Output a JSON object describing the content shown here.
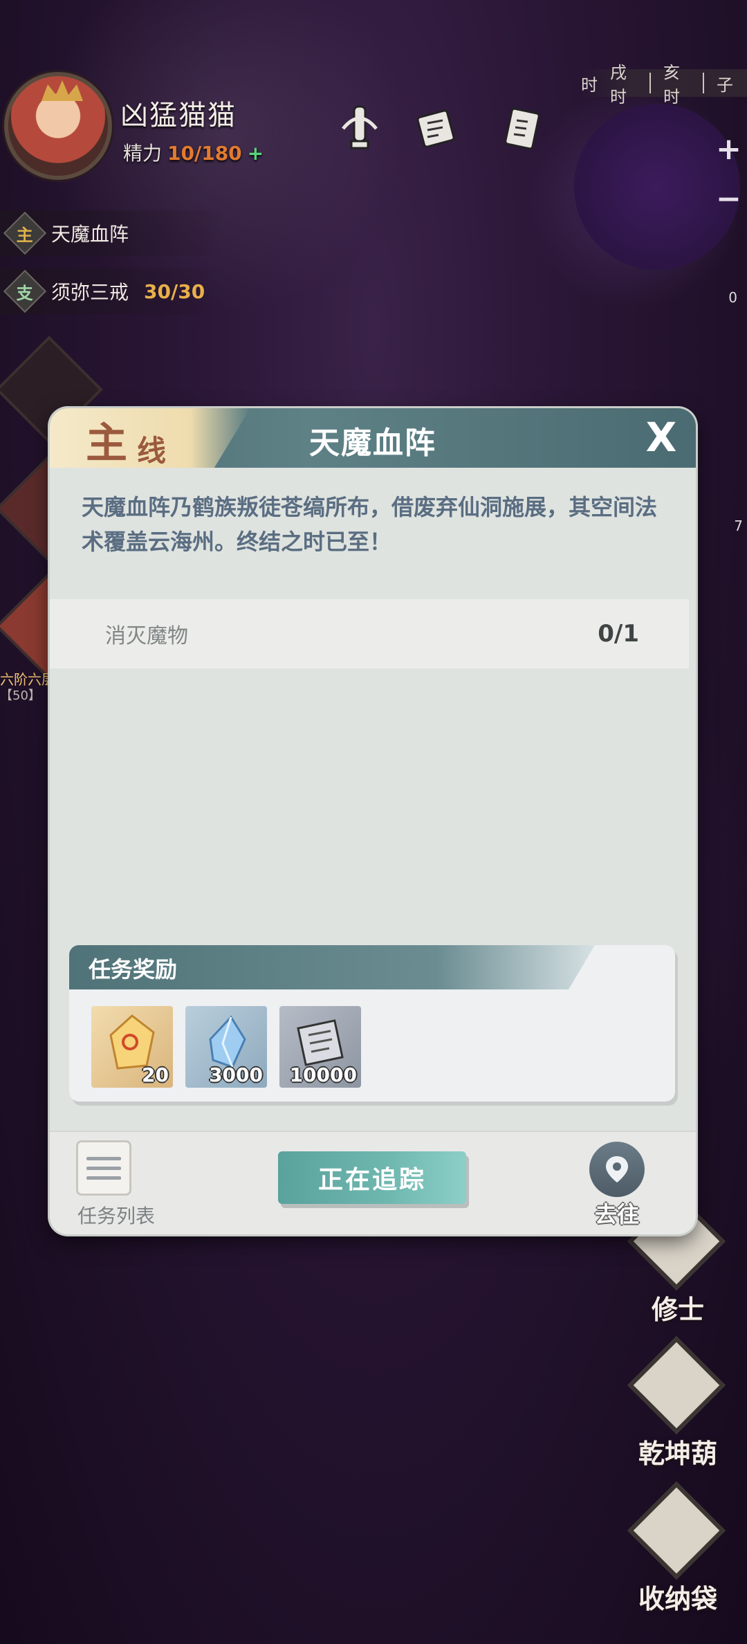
{
  "player": {
    "name": "凶猛猫猫",
    "energy_label": "精力",
    "energy_value": "10/180",
    "energy_plus": "+"
  },
  "time_strip": {
    "items": [
      "时",
      "戌时",
      "亥时",
      "子"
    ]
  },
  "zoom": {
    "plus": "+",
    "minus": "−"
  },
  "quests": {
    "main": {
      "tag": "主",
      "name": "天魔血阵"
    },
    "side": {
      "tag": "支",
      "name": "须弥三戒",
      "progress": "30/30"
    }
  },
  "left_floor": {
    "label": "六阶六层",
    "level": "【50】"
  },
  "right_counter": "0",
  "right_small_number": "7",
  "side_buttons": [
    {
      "label": "修士"
    },
    {
      "label": "乾坤葫"
    },
    {
      "label": "收纳袋"
    }
  ],
  "modal": {
    "badge_main": "主",
    "badge_line": "线",
    "title": "天魔血阵",
    "close": "X",
    "description": "天魔血阵乃鹤族叛徒苍缟所布，借废弃仙洞施展，其空间法术覆盖云海州。终结之时已至！",
    "objective": {
      "name": "消灭魔物",
      "progress": "0/1"
    },
    "rewards_title": "任务奖励",
    "rewards": [
      {
        "icon": "gold-crystal-icon",
        "count": "20"
      },
      {
        "icon": "blue-crystal-icon",
        "count": "3000"
      },
      {
        "icon": "scroll-icon",
        "count": "10000"
      }
    ],
    "footer": {
      "list_label": "任务列表",
      "track_label": "正在追踪",
      "goto_label": "去往"
    }
  },
  "colors": {
    "accent_teal": "#5aa29c",
    "header_teal": "#4b6d73",
    "energy_orange": "#e27b2f",
    "progress_gold": "#e8b04a"
  }
}
